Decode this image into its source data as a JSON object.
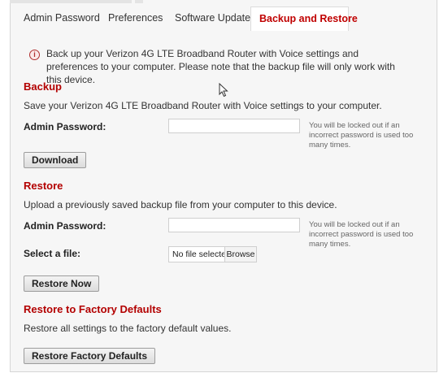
{
  "tabs": [
    {
      "label": "Admin Password"
    },
    {
      "label": "Preferences"
    },
    {
      "label": "Software Update"
    },
    {
      "label": "Backup and Restore",
      "active": true
    }
  ],
  "notice": {
    "text": "Back up your Verizon 4G LTE Broadband Router with Voice settings and preferences to your computer. Please note that the backup file will only work with this device."
  },
  "backup": {
    "title": "Backup",
    "description": "Save your Verizon 4G LTE Broadband Router with Voice settings to your computer.",
    "password_label": "Admin Password:",
    "password_value": "",
    "password_hint": "You will be locked out if an incorrect password is used too many times.",
    "button_label": "Download"
  },
  "restore": {
    "title": "Restore",
    "description": "Upload a previously saved backup file from your computer to this device.",
    "password_label": "Admin Password:",
    "password_value": "",
    "password_hint": "You will be locked out if an incorrect password is used too many times.",
    "file_label": "Select a file:",
    "file_status": "No file selected",
    "browse_label": "Browse",
    "button_label": "Restore Now"
  },
  "factory": {
    "title": "Restore to Factory Defaults",
    "description": "Restore all settings to the factory default values.",
    "button_label": "Restore Factory Defaults"
  },
  "colors": {
    "accent": "#b30000",
    "active_tab_text": "#c00000",
    "panel_background": "#f6f6f6"
  }
}
